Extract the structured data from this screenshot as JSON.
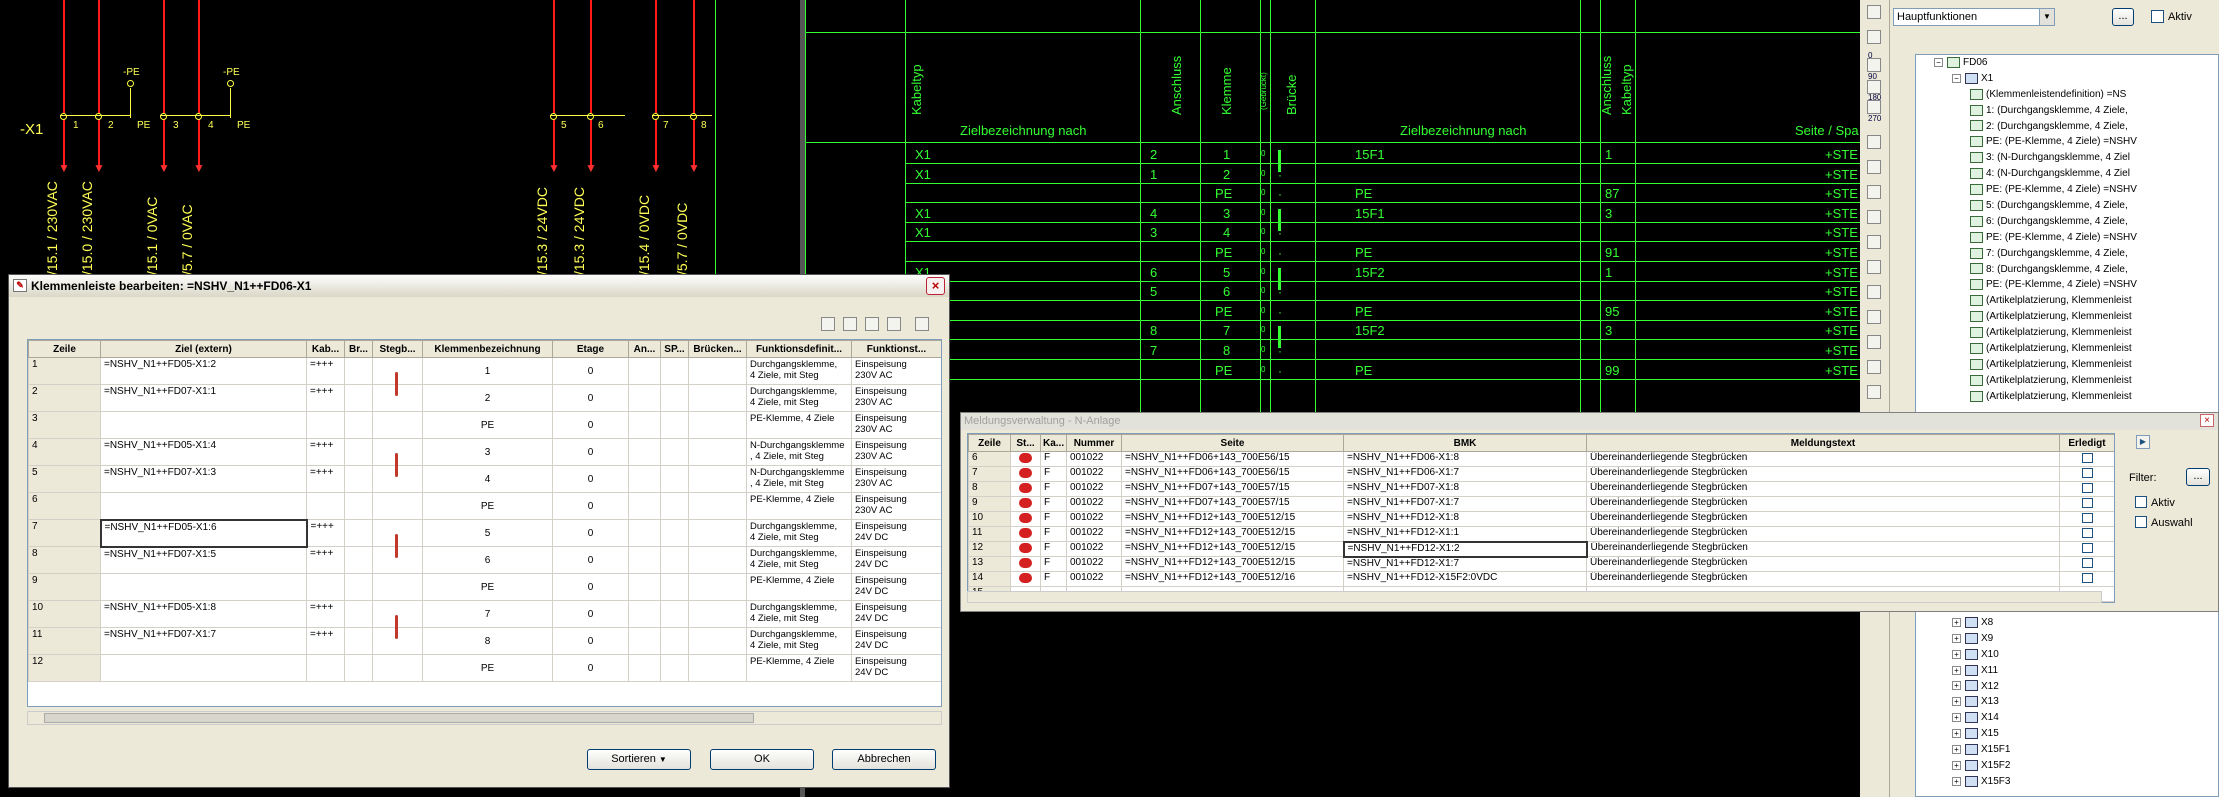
{
  "schematic_left": {
    "terminal_strip_label": "-X1",
    "terminals": [
      "1",
      "2",
      "3",
      "4"
    ],
    "pe_labels": [
      "PE",
      "PE"
    ],
    "pe_top_labels": [
      "-PE",
      "-PE"
    ],
    "rotated_labels": [
      "/15.1 / 230VAC",
      "/15.0 / 230VAC",
      "/15.1 / 0VAC",
      "/5.7 / 0VAC"
    ],
    "right_terminals": [
      "5",
      "6",
      "7",
      "8"
    ],
    "right_rotated_labels": [
      "/15.3 / 24VDC",
      "/15.3 / 24VDC",
      "/15.4 / 0VDC",
      "/5.7 / 0VDC"
    ]
  },
  "schematic_table": {
    "headers_rotated": [
      "Kabeltyp",
      "Anschluss",
      "Klemme",
      "(Gebrückt)",
      "Brücke",
      "Anschluss",
      "Kabeltyp"
    ],
    "col_header_left": "Zielbezeichnung nach",
    "col_header_right": "Zielbezeichnung nach",
    "col_header_far": "Seite / Spa",
    "rows": [
      {
        "ziel": "X1",
        "ans": "2",
        "klemme": "1",
        "g": "0",
        "bridge": true,
        "ziel2": "15F1",
        "ans2": "1",
        "ste": "+STE"
      },
      {
        "ziel": "X1",
        "ans": "1",
        "klemme": "2",
        "g": "0",
        "bridge": false,
        "ziel2": "",
        "ans2": "",
        "ste": "+STE"
      },
      {
        "ziel": "",
        "ans": "",
        "klemme": "PE",
        "g": "0",
        "bridge": false,
        "ziel2": "PE",
        "ans2": "87",
        "ste": "+STE"
      },
      {
        "ziel": "X1",
        "ans": "4",
        "klemme": "3",
        "g": "0",
        "bridge": true,
        "ziel2": "15F1",
        "ans2": "3",
        "ste": "+STE"
      },
      {
        "ziel": "X1",
        "ans": "3",
        "klemme": "4",
        "g": "0",
        "bridge": false,
        "ziel2": "",
        "ans2": "",
        "ste": "+STE"
      },
      {
        "ziel": "",
        "ans": "",
        "klemme": "PE",
        "g": "0",
        "bridge": false,
        "ziel2": "PE",
        "ans2": "91",
        "ste": "+STE"
      },
      {
        "ziel": "X1",
        "ans": "6",
        "klemme": "5",
        "g": "0",
        "bridge": true,
        "ziel2": "15F2",
        "ans2": "1",
        "ste": "+STE"
      },
      {
        "ziel": "",
        "ans": "5",
        "klemme": "6",
        "g": "0",
        "bridge": false,
        "ziel2": "",
        "ans2": "",
        "ste": "+STE"
      },
      {
        "ziel": "",
        "ans": "",
        "klemme": "PE",
        "g": "0",
        "bridge": false,
        "ziel2": "PE",
        "ans2": "95",
        "ste": "+STE"
      },
      {
        "ziel": "",
        "ans": "8",
        "klemme": "7",
        "g": "0",
        "bridge": true,
        "ziel2": "15F2",
        "ans2": "3",
        "ste": "+STE"
      },
      {
        "ziel": "",
        "ans": "7",
        "klemme": "8",
        "g": "0",
        "bridge": false,
        "ziel2": "",
        "ans2": "",
        "ste": "+STE"
      },
      {
        "ziel": "",
        "ans": "",
        "klemme": "PE",
        "g": "0",
        "bridge": false,
        "ziel2": "PE",
        "ans2": "99",
        "ste": "+STE"
      }
    ]
  },
  "dialog": {
    "title": "Klemmenleiste bearbeiten: =NSHV_N1++FD06-X1",
    "columns": [
      "Zeile",
      "Ziel (extern)",
      "Kab...",
      "Br...",
      "Stegb...",
      "Klemmenbezeichnung",
      "Etage",
      "An...",
      "SP...",
      "Brücken...",
      "Funktionsdefinit...",
      "Funktionst..."
    ],
    "rows": [
      {
        "zeile": "1",
        "ziel": "=NSHV_N1++FD05-X1:2",
        "kab": "=+++",
        "steg": true,
        "klemme": "1",
        "etage": "0",
        "fdef": "Durchgangsklemme,\n4 Ziele, mit Steg",
        "ftyp": "Einspeisung\n230V AC"
      },
      {
        "zeile": "2",
        "ziel": "=NSHV_N1++FD07-X1:1",
        "kab": "=+++",
        "steg": false,
        "klemme": "2",
        "etage": "0",
        "fdef": "Durchgangsklemme,\n4 Ziele, mit Steg",
        "ftyp": "Einspeisung\n230V AC"
      },
      {
        "zeile": "3",
        "ziel": "",
        "kab": "",
        "steg": false,
        "klemme": "PE",
        "etage": "0",
        "fdef": "PE-Klemme, 4 Ziele",
        "ftyp": "Einspeisung\n230V AC"
      },
      {
        "zeile": "4",
        "ziel": "=NSHV_N1++FD05-X1:4",
        "kab": "=+++",
        "steg": true,
        "klemme": "3",
        "etage": "0",
        "fdef": "N-Durchgangsklemme\n, 4 Ziele, mit Steg",
        "ftyp": "Einspeisung\n230V AC"
      },
      {
        "zeile": "5",
        "ziel": "=NSHV_N1++FD07-X1:3",
        "kab": "=+++",
        "steg": false,
        "klemme": "4",
        "etage": "0",
        "fdef": "N-Durchgangsklemme\n, 4 Ziele, mit Steg",
        "ftyp": "Einspeisung\n230V AC"
      },
      {
        "zeile": "6",
        "ziel": "",
        "kab": "",
        "steg": false,
        "klemme": "PE",
        "etage": "0",
        "fdef": "PE-Klemme, 4 Ziele",
        "ftyp": "Einspeisung\n230V AC"
      },
      {
        "zeile": "7",
        "ziel": "=NSHV_N1++FD05-X1:6",
        "kab": "=+++",
        "steg": true,
        "klemme": "5",
        "etage": "0",
        "fdef": "Durchgangsklemme,\n4 Ziele, mit Steg",
        "ftyp": "Einspeisung\n24V DC"
      },
      {
        "zeile": "8",
        "ziel": "=NSHV_N1++FD07-X1:5",
        "kab": "=+++",
        "steg": false,
        "klemme": "6",
        "etage": "0",
        "fdef": "Durchgangsklemme,\n4 Ziele, mit Steg",
        "ftyp": "Einspeisung\n24V DC"
      },
      {
        "zeile": "9",
        "ziel": "",
        "kab": "",
        "steg": false,
        "klemme": "PE",
        "etage": "0",
        "fdef": "PE-Klemme, 4 Ziele",
        "ftyp": "Einspeisung\n24V DC"
      },
      {
        "zeile": "10",
        "ziel": "=NSHV_N1++FD05-X1:8",
        "kab": "=+++",
        "steg": true,
        "klemme": "7",
        "etage": "0",
        "fdef": "Durchgangsklemme,\n4 Ziele, mit Steg",
        "ftyp": "Einspeisung\n24V DC"
      },
      {
        "zeile": "11",
        "ziel": "=NSHV_N1++FD07-X1:7",
        "kab": "=+++",
        "steg": false,
        "klemme": "8",
        "etage": "0",
        "fdef": "Durchgangsklemme,\n4 Ziele, mit Steg",
        "ftyp": "Einspeisung\n24V DC"
      },
      {
        "zeile": "12",
        "ziel": "",
        "kab": "",
        "steg": false,
        "klemme": "PE",
        "etage": "0",
        "fdef": "PE-Klemme, 4 Ziele",
        "ftyp": "Einspeisung\n24V DC"
      }
    ],
    "buttons": {
      "sort": "Sortieren",
      "ok": "OK",
      "cancel": "Abbrechen"
    }
  },
  "messages": {
    "title": "Meldungsverwaltung - N-Anlage",
    "columns": [
      "Zeile",
      "St...",
      "Ka...",
      "Nummer",
      "Seite",
      "BMK",
      "Meldungstext",
      "Erledigt"
    ],
    "rows": [
      {
        "zeile": "6",
        "ka": "F",
        "nummer": "001022",
        "seite": "=NSHV_N1++FD06+143_700E56/15",
        "bmk": "=NSHV_N1++FD06-X1:8",
        "text": "Übereinanderliegende Stegbrücken"
      },
      {
        "zeile": "7",
        "ka": "F",
        "nummer": "001022",
        "seite": "=NSHV_N1++FD06+143_700E56/15",
        "bmk": "=NSHV_N1++FD06-X1:7",
        "text": "Übereinanderliegende Stegbrücken"
      },
      {
        "zeile": "8",
        "ka": "F",
        "nummer": "001022",
        "seite": "=NSHV_N1++FD07+143_700E57/15",
        "bmk": "=NSHV_N1++FD07-X1:8",
        "text": "Übereinanderliegende Stegbrücken"
      },
      {
        "zeile": "9",
        "ka": "F",
        "nummer": "001022",
        "seite": "=NSHV_N1++FD07+143_700E57/15",
        "bmk": "=NSHV_N1++FD07-X1:7",
        "text": "Übereinanderliegende Stegbrücken"
      },
      {
        "zeile": "10",
        "ka": "F",
        "nummer": "001022",
        "seite": "=NSHV_N1++FD12+143_700E512/15",
        "bmk": "=NSHV_N1++FD12-X1:8",
        "text": "Übereinanderliegende Stegbrücken"
      },
      {
        "zeile": "11",
        "ka": "F",
        "nummer": "001022",
        "seite": "=NSHV_N1++FD12+143_700E512/15",
        "bmk": "=NSHV_N1++FD12-X1:1",
        "text": "Übereinanderliegende Stegbrücken"
      },
      {
        "zeile": "12",
        "ka": "F",
        "nummer": "001022",
        "seite": "=NSHV_N1++FD12+143_700E512/15",
        "bmk": "=NSHV_N1++FD12-X1:2",
        "text": "Übereinanderliegende Stegbrücken"
      },
      {
        "zeile": "13",
        "ka": "F",
        "nummer": "001022",
        "seite": "=NSHV_N1++FD12+143_700E512/15",
        "bmk": "=NSHV_N1++FD12-X1:7",
        "text": "Übereinanderliegende Stegbrücken"
      },
      {
        "zeile": "14",
        "ka": "F",
        "nummer": "001022",
        "seite": "=NSHV_N1++FD12+143_700E512/16",
        "bmk": "=NSHV_N1++FD12-X15F2:0VDC",
        "text": "Übereinanderliegende Stegbrücken"
      },
      {
        "zeile": "15",
        "ka": "",
        "nummer": "",
        "seite": "",
        "bmk": "",
        "text": ""
      }
    ],
    "filter_label": "Filter:",
    "aktiv_label": "Aktiv",
    "auswahl_label": "Auswahl"
  },
  "navigator": {
    "filter_select": "Hauptfunktionen",
    "aktiv_label": "Aktiv",
    "tree_top": [
      {
        "indent": 0,
        "label": "FD06",
        "expand": "−",
        "icon": "cab"
      },
      {
        "indent": 1,
        "label": "X1",
        "expand": "−",
        "icon": "xy"
      },
      {
        "indent": 2,
        "label": "(Klemmenleistendefinition) =NS",
        "icon": "def"
      },
      {
        "indent": 2,
        "label": "1: (Durchgangsklemme, 4 Ziele,",
        "icon": "term"
      },
      {
        "indent": 2,
        "label": "2: (Durchgangsklemme, 4 Ziele,",
        "icon": "term"
      },
      {
        "indent": 2,
        "label": "PE: (PE-Klemme, 4 Ziele) =NSHV",
        "icon": "term"
      },
      {
        "indent": 2,
        "label": "3: (N-Durchgangsklemme, 4 Ziel",
        "icon": "term"
      },
      {
        "indent": 2,
        "label": "4: (N-Durchgangsklemme, 4 Ziel",
        "icon": "term"
      },
      {
        "indent": 2,
        "label": "PE: (PE-Klemme, 4 Ziele) =NSHV",
        "icon": "term"
      },
      {
        "indent": 2,
        "label": "5: (Durchgangsklemme, 4 Ziele,",
        "icon": "term"
      },
      {
        "indent": 2,
        "label": "6: (Durchgangsklemme, 4 Ziele,",
        "icon": "term"
      },
      {
        "indent": 2,
        "label": "PE: (PE-Klemme, 4 Ziele) =NSHV",
        "icon": "term"
      },
      {
        "indent": 2,
        "label": "7: (Durchgangsklemme, 4 Ziele,",
        "icon": "term"
      },
      {
        "indent": 2,
        "label": "8: (Durchgangsklemme, 4 Ziele,",
        "icon": "term"
      },
      {
        "indent": 2,
        "label": "PE: (PE-Klemme, 4 Ziele) =NSHV",
        "icon": "term"
      },
      {
        "indent": 2,
        "label": "(Artikelplatzierung, Klemmenleist",
        "icon": "art"
      },
      {
        "indent": 2,
        "label": "(Artikelplatzierung, Klemmenleist",
        "icon": "art"
      },
      {
        "indent": 2,
        "label": "(Artikelplatzierung, Klemmenleist",
        "icon": "art"
      },
      {
        "indent": 2,
        "label": "(Artikelplatzierung, Klemmenleist",
        "icon": "art"
      },
      {
        "indent": 2,
        "label": "(Artikelplatzierung, Klemmenleist",
        "icon": "art"
      },
      {
        "indent": 2,
        "label": "(Artikelplatzierung, Klemmenleist",
        "icon": "art"
      },
      {
        "indent": 2,
        "label": "(Artikelplatzierung, Klemmenleist",
        "icon": "art"
      }
    ],
    "tree_bottom": [
      "X8",
      "X9",
      "X10",
      "X11",
      "X12",
      "X13",
      "X14",
      "X15",
      "X15F1",
      "X15F2",
      "X15F3"
    ],
    "toolbar_numbers": [
      "0",
      "90",
      "180",
      "270"
    ]
  }
}
